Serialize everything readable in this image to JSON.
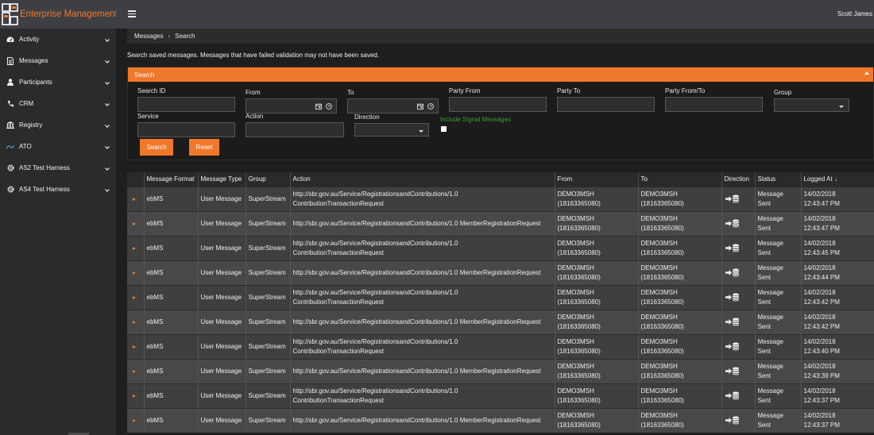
{
  "app": {
    "title": "Enterprise Management",
    "accent": "#f0782a"
  },
  "user": {
    "name": "Scott James"
  },
  "sidebar": {
    "items": [
      {
        "label": "Activity",
        "icon": "dashboard-icon"
      },
      {
        "label": "Messages",
        "icon": "document-icon"
      },
      {
        "label": "Participants",
        "icon": "person-icon"
      },
      {
        "label": "CRM",
        "icon": "phone-icon"
      },
      {
        "label": "Registry",
        "icon": "bank-icon"
      },
      {
        "label": "ATO",
        "icon": "ato-icon"
      },
      {
        "label": "AS2 Test Harness",
        "icon": "gear-icon"
      },
      {
        "label": "AS4 Test Harness",
        "icon": "gear-icon"
      }
    ]
  },
  "breadcrumb": {
    "root": "Messages",
    "current": "Search"
  },
  "info_text": "Search saved messages. Messages that have failed validation may not have been saved.",
  "search": {
    "panel_title": "Search",
    "search_id_label": "Search ID",
    "from_label": "From",
    "to_label": "To",
    "party_from_label": "Party From",
    "party_to_label": "Party To",
    "party_from_to_label": "Party From/To",
    "group_label": "Group",
    "service_label": "Service",
    "action_label": "Action",
    "direction_label": "Direction",
    "include_signal_label": "Include Signal Messages",
    "search_button": "Search",
    "reset_button": "Reset"
  },
  "table": {
    "columns": [
      "Message Format",
      "Message Type",
      "Group",
      "Action",
      "From",
      "To",
      "Direction",
      "Status",
      "Logged At"
    ],
    "rows": [
      {
        "format": "ebMS",
        "type": "User Message",
        "group": "SuperStream",
        "action_1": "http://sbr.gov.au/Service/RegistrationsandContributions/1.0",
        "action_2": "ContributionTransactionRequest",
        "from_1": "DEMO3MSH",
        "from_2": "(18163365080)",
        "to_1": "DEMO3MSH",
        "to_2": "(18163365080)",
        "status_1": "Message",
        "status_2": "Sent",
        "logged_1": "14/02/2018",
        "logged_2": "12:43:47 PM"
      },
      {
        "format": "ebMS",
        "type": "User Message",
        "group": "SuperStream",
        "action_1": "http://sbr.gov.au/Service/RegistrationsandContributions/1.0 MemberRegistrationRequest",
        "action_2": "",
        "from_1": "DEMO3MSH",
        "from_2": "(18163365080)",
        "to_1": "DEMO3MSH",
        "to_2": "(18163365080)",
        "status_1": "Message",
        "status_2": "Sent",
        "logged_1": "14/02/2018",
        "logged_2": "12:43:47 PM"
      },
      {
        "format": "ebMS",
        "type": "User Message",
        "group": "SuperStream",
        "action_1": "http://sbr.gov.au/Service/RegistrationsandContributions/1.0",
        "action_2": "ContributionTransactionRequest",
        "from_1": "DEMO3MSH",
        "from_2": "(18163365080)",
        "to_1": "DEMO3MSH",
        "to_2": "(18163365080)",
        "status_1": "Message",
        "status_2": "Sent",
        "logged_1": "14/02/2018",
        "logged_2": "12:43:45 PM"
      },
      {
        "format": "ebMS",
        "type": "User Message",
        "group": "SuperStream",
        "action_1": "http://sbr.gov.au/Service/RegistrationsandContributions/1.0 MemberRegistrationRequest",
        "action_2": "",
        "from_1": "DEMO3MSH",
        "from_2": "(18163365080)",
        "to_1": "DEMO3MSH",
        "to_2": "(18163365080)",
        "status_1": "Message",
        "status_2": "Sent",
        "logged_1": "14/02/2018",
        "logged_2": "12:43:44 PM"
      },
      {
        "format": "ebMS",
        "type": "User Message",
        "group": "SuperStream",
        "action_1": "http://sbr.gov.au/Service/RegistrationsandContributions/1.0",
        "action_2": "ContributionTransactionRequest",
        "from_1": "DEMO3MSH",
        "from_2": "(18163365080)",
        "to_1": "DEMO3MSH",
        "to_2": "(18163365080)",
        "status_1": "Message",
        "status_2": "Sent",
        "logged_1": "14/02/2018",
        "logged_2": "12:43:42 PM"
      },
      {
        "format": "ebMS",
        "type": "User Message",
        "group": "SuperStream",
        "action_1": "http://sbr.gov.au/Service/RegistrationsandContributions/1.0 MemberRegistrationRequest",
        "action_2": "",
        "from_1": "DEMO3MSH",
        "from_2": "(18163365080)",
        "to_1": "DEMO3MSH",
        "to_2": "(18163365080)",
        "status_1": "Message",
        "status_2": "Sent",
        "logged_1": "14/02/2018",
        "logged_2": "12:43:42 PM"
      },
      {
        "format": "ebMS",
        "type": "User Message",
        "group": "SuperStream",
        "action_1": "http://sbr.gov.au/Service/RegistrationsandContributions/1.0",
        "action_2": "ContributionTransactionRequest",
        "from_1": "DEMO3MSH",
        "from_2": "(18163365080)",
        "to_1": "DEMO3MSH",
        "to_2": "(18163365080)",
        "status_1": "Message",
        "status_2": "Sent",
        "logged_1": "14/02/2018",
        "logged_2": "12:43:40 PM"
      },
      {
        "format": "ebMS",
        "type": "User Message",
        "group": "SuperStream",
        "action_1": "http://sbr.gov.au/Service/RegistrationsandContributions/1.0 MemberRegistrationRequest",
        "action_2": "",
        "from_1": "DEMO3MSH",
        "from_2": "(18163365080)",
        "to_1": "DEMO3MSH",
        "to_2": "(18163365080)",
        "status_1": "Message",
        "status_2": "Sent",
        "logged_1": "14/02/2018",
        "logged_2": "12:43:39 PM"
      },
      {
        "format": "ebMS",
        "type": "User Message",
        "group": "SuperStream",
        "action_1": "http://sbr.gov.au/Service/RegistrationsandContributions/1.0",
        "action_2": "ContributionTransactionRequest",
        "from_1": "DEMO3MSH",
        "from_2": "(18163365080)",
        "to_1": "DEMO3MSH",
        "to_2": "(18163365080)",
        "status_1": "Message",
        "status_2": "Sent",
        "logged_1": "14/02/2018",
        "logged_2": "12:43:37 PM"
      },
      {
        "format": "ebMS",
        "type": "User Message",
        "group": "SuperStream",
        "action_1": "http://sbr.gov.au/Service/RegistrationsandContributions/1.0 MemberRegistrationRequest",
        "action_2": "",
        "from_1": "DEMO3MSH",
        "from_2": "(18163365080)",
        "to_1": "DEMO3MSH",
        "to_2": "(18163365080)",
        "status_1": "Message",
        "status_2": "Sent",
        "logged_1": "14/02/2018",
        "logged_2": "12:43:37 PM"
      }
    ]
  }
}
